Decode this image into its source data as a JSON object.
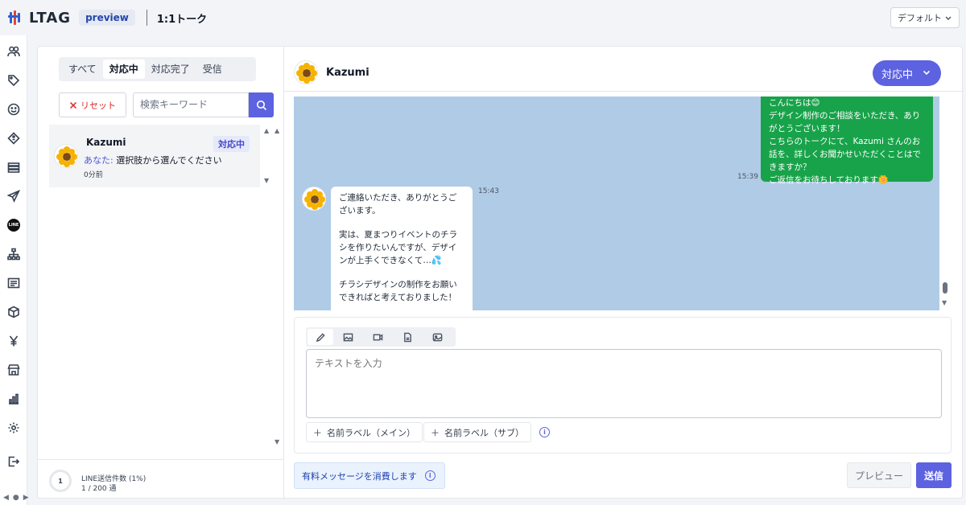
{
  "header": {
    "logo_text": "LTAG",
    "badge": "preview",
    "title": "1:1トーク",
    "view_select": "デフォルト"
  },
  "colors": {
    "accent": "#5c62e0",
    "outgoing_bubble": "#18a34a",
    "chat_background": "#b0cbe6",
    "reset_red": "#dc2626"
  },
  "rail": {
    "icons": [
      "users-icon",
      "tag-icon",
      "smile-icon",
      "coupon-icon",
      "list-icon",
      "send-icon",
      "line-icon",
      "hierarchy-icon",
      "form-icon",
      "box-icon",
      "yen-icon",
      "store-icon",
      "chart-icon",
      "settings-icon",
      "logout-icon"
    ],
    "line_label": "LINE"
  },
  "list": {
    "tabs": [
      {
        "label": "すべて",
        "active": false
      },
      {
        "label": "対応中",
        "active": true
      },
      {
        "label": "対応完了",
        "active": false
      },
      {
        "label": "受信",
        "active": false
      }
    ],
    "reset_label": "リセット",
    "search_placeholder": "検索キーワード",
    "conversations": [
      {
        "name": "Kazumi",
        "status": "対応中",
        "preview_prefix": "あなた:",
        "preview_text": "選択肢から選んでください",
        "time": "0分前"
      }
    ],
    "quota": {
      "ring_value": "1",
      "title": "LINE送信件数 (1%)",
      "count": "1 / 200 通",
      "percent": 1
    }
  },
  "chat": {
    "contact_name": "Kazumi",
    "status_button": "対応中",
    "messages": [
      {
        "direction": "out",
        "lines": [
          "こんにちは😊",
          "デザイン制作のご相談をいただき、あり",
          "がとうございます！",
          "こちらのトークにて、Kazumi さんのお",
          "話を、詳しくお聞かせいただくことはで",
          "きますか？",
          "ご返信をお待ちしております🌼"
        ],
        "time": "15:39"
      },
      {
        "direction": "in",
        "paragraphs": [
          "ご連絡いただき、ありがとうございます。",
          "実は、夏まつりイベントのチラシを作りたいんですが、デザインが上手くできなくて…💦",
          "チラシデザインの制作をお願いできればと考えておりました！"
        ],
        "time": "15:43"
      }
    ]
  },
  "composer": {
    "type_tabs": [
      "text-icon",
      "image-icon",
      "video-icon",
      "file-icon",
      "media-icon"
    ],
    "input_placeholder": "テキストを入力",
    "label_main": "名前ラベル（メイン）",
    "label_sub": "名前ラベル（サブ）"
  },
  "footer": {
    "paid_note": "有料メッセージを消費します",
    "preview_label": "プレビュー",
    "send_label": "送信"
  }
}
